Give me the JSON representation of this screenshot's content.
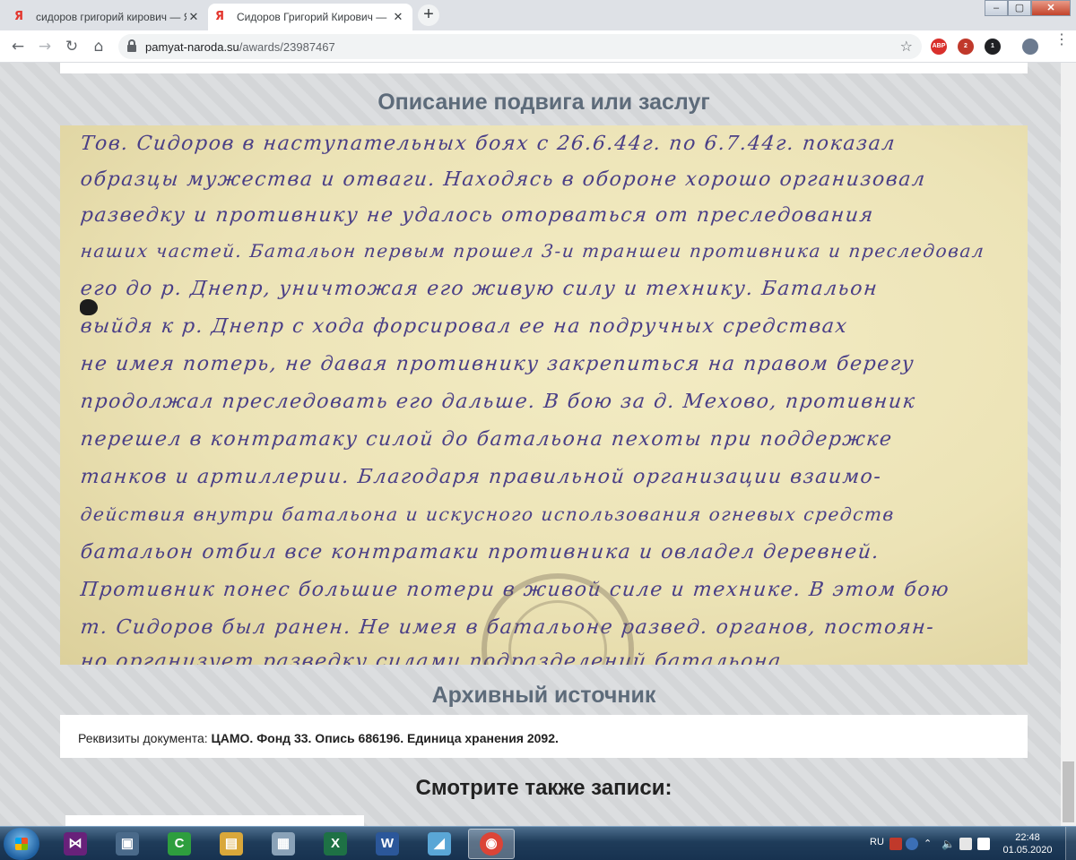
{
  "browser": {
    "tabs": [
      {
        "favicon": "Я",
        "title": "сидоров григорий кирович — Я",
        "active": false
      },
      {
        "favicon": "Я",
        "title": "Сидоров Григорий Кирович —",
        "active": true
      }
    ],
    "new_tab_glyph": "+",
    "url_host": "pamyat-naroda.su",
    "url_path": "/awards/23987467",
    "extensions": [
      {
        "name": "adblock-plus-icon",
        "color": "#d9302c",
        "label": "ABP"
      },
      {
        "name": "extension-red-icon",
        "color": "#c0392b",
        "badge": "2"
      },
      {
        "name": "extension-box-icon",
        "color": "#202124",
        "badge": "1"
      }
    ]
  },
  "page": {
    "section_title": "Описание подвига или заслуг",
    "document_lines": [
      "Тов. Сидоров в наступательных боях с 26.6.44г. по 6.7.44г. показал",
      "образцы мужества и отваги. Находясь в обороне хорошо организовал",
      "разведку и противнику не удалось оторваться от преследования",
      "наших частей. Батальон первым прошел 3-и траншеи противника и преследовал",
      "его до р. Днепр, уничтожая его живую силу и технику. Батальон",
      "выйдя к р. Днепр с хода форсировал ее на подручных средствах",
      "не имея потерь, не давая противнику закрепиться на правом берегу",
      "продолжал преследовать его дальше. В бою за д. Мехово, противник",
      "перешел в контратаку силой до батальона пехоты при поддержке",
      "танков и артиллерии. Благодаря правильной организации взаимо-",
      "действия внутри батальона и искусного использования огневых средств",
      "батальон отбил все контратаки противника и овладел деревней.",
      "Противник понес большие потери в живой силе и технике. В этом бою",
      "т. Сидоров был ранен. Не имея в батальоне развед. органов, постоян-",
      "но организует разведку силами подразделений батальона"
    ],
    "archive_title": "Архивный источник",
    "archive_label": "Реквизиты документа: ",
    "archive_value": "ЦАМО. Фонд 33. Опись 686196. Единица хранения 2092.",
    "see_also_title": "Смотрите также записи:"
  },
  "taskbar": {
    "apps": [
      {
        "name": "visual-studio-icon",
        "glyph": "⋈",
        "color": "#68217a"
      },
      {
        "name": "computer-icon",
        "glyph": "▣",
        "color": "#4a6a8a"
      },
      {
        "name": "camtasia-icon",
        "glyph": "C",
        "color": "#2e9e3e"
      },
      {
        "name": "explorer-folder-icon",
        "glyph": "▤",
        "color": "#d9a73a"
      },
      {
        "name": "calculator-icon",
        "glyph": "▦",
        "color": "#8aa2b8"
      },
      {
        "name": "excel-icon",
        "glyph": "X",
        "color": "#1e7145"
      },
      {
        "name": "word-icon",
        "glyph": "W",
        "color": "#2b579a"
      },
      {
        "name": "paint-icon",
        "glyph": "◢",
        "color": "#5aa6d6"
      },
      {
        "name": "chrome-icon",
        "glyph": "◉",
        "color": "#db4437"
      }
    ],
    "language": "RU",
    "time": "22:48",
    "date": "01.05.2020"
  }
}
